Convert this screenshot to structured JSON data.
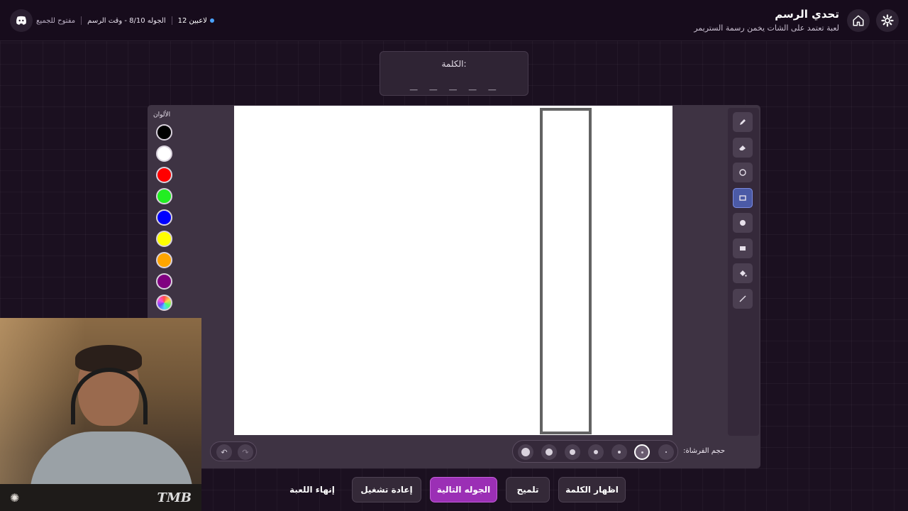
{
  "header": {
    "title": "تحدي الرسم",
    "subtitle": "لعبة تعتمد على الشات يخمن رسمة الستريمر",
    "players": "12 لاعبين",
    "round_info": "الجوله 8/10 - وقت الرسم",
    "status": "مفتوح للجميع",
    "home_icon": "home-icon",
    "settings_icon": "gear-icon",
    "discord_icon": "discord-icon"
  },
  "word": {
    "label": "الكلمة:",
    "blanks": "_ _ _ _ _"
  },
  "palette": {
    "title": "الألوان",
    "colors": [
      "#000000",
      "#ffffff",
      "#ff0000",
      "#22ee22",
      "#0000ff",
      "#ffff00",
      "#ffa500",
      "#800080"
    ]
  },
  "tools": [
    {
      "name": "pencil-icon",
      "active": false
    },
    {
      "name": "eraser-icon",
      "active": false
    },
    {
      "name": "circle-outline-icon",
      "active": false
    },
    {
      "name": "rectangle-outline-icon",
      "active": true
    },
    {
      "name": "circle-filled-icon",
      "active": false
    },
    {
      "name": "rectangle-filled-icon",
      "active": false
    },
    {
      "name": "fill-bucket-icon",
      "active": false
    },
    {
      "name": "line-icon",
      "active": false
    }
  ],
  "brush": {
    "label": "حجم الفرشاة:",
    "selected_index": 1
  },
  "actions": {
    "show_word": "اظهار الكلمة",
    "hint": "تلميح",
    "next_round": "الجوله التالية",
    "restart": "إعادة تشغيل",
    "end_game": "إنهاء اللعبة"
  },
  "webcam": {
    "banner_tag": "TMB"
  }
}
